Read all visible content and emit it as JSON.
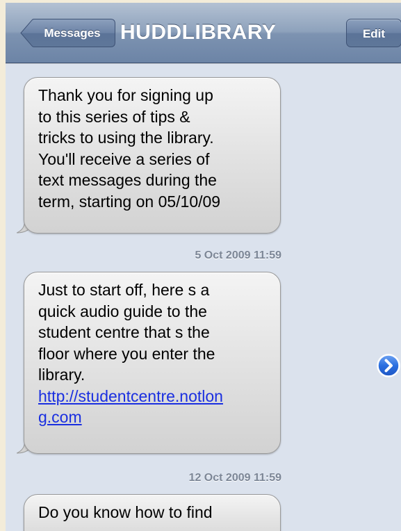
{
  "navbar": {
    "back_label": "Messages",
    "title": "HUDDLIBRARY",
    "edit_label": "Edit"
  },
  "messages": [
    {
      "lines": [
        "Thank you for signing up",
        "to this series of tips &",
        "tricks to using the library.",
        "You'll receive a series of",
        "text messages during the",
        "term, starting on 05/10/09"
      ]
    },
    {
      "lines": [
        "Just to start off, here s a",
        "quick audio guide to the",
        "student centre that s the",
        "floor where you enter the",
        "library."
      ],
      "link_lines": [
        "http://studentcentre.notlon",
        "g.com"
      ]
    },
    {
      "lines": [
        "Do you know how to find"
      ]
    }
  ],
  "timestamps": [
    "5 Oct 2009 11:59",
    "12 Oct 2009 11:59"
  ],
  "icons": {
    "back": "left-arrow-button-shape",
    "disclosure": "blue-chevron-right-icon"
  },
  "colors": {
    "navbar": "#7d93b1",
    "background": "#dbe2ed",
    "link": "#1a2fe0",
    "timestamp": "#7c8696"
  }
}
